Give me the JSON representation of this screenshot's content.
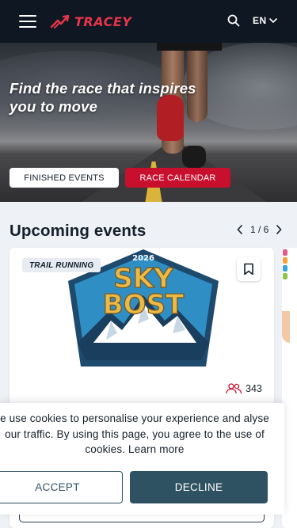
{
  "header": {
    "menu_icon": "hamburger-menu-icon",
    "logo_text": "TRACEY",
    "search_icon": "search-icon",
    "language": "EN",
    "language_icon": "chevron-down-icon",
    "background": "#0e1722",
    "logo_color": "#e8344a"
  },
  "hero": {
    "headline": "Find the race that inspires you to move",
    "finished_events_label": "FINISHED EVENTS",
    "race_calendar_label": "RACE CALENDAR",
    "accent": "#c8102e"
  },
  "upcoming": {
    "title": "Upcoming events",
    "pager": {
      "current": "1",
      "separator": "/",
      "total": "6",
      "text": "1 / 6"
    },
    "cards": [
      {
        "category": "TRAIL RUNNING",
        "logo_year": "2026",
        "logo_line1": "SKY",
        "logo_line2": "BOST",
        "participants": "343",
        "bookmark_icon": "bookmark-icon",
        "participants_icon": "people-icon"
      }
    ]
  },
  "cookie_banner": {
    "message": "e use cookies to personalise your experience and alyse our traffic. By using this page, you agree to the use of cookies.",
    "learn_more": "Learn more",
    "accept_label": "ACCEPT",
    "decline_label": "DECLINE",
    "button_color": "#2f5263"
  }
}
